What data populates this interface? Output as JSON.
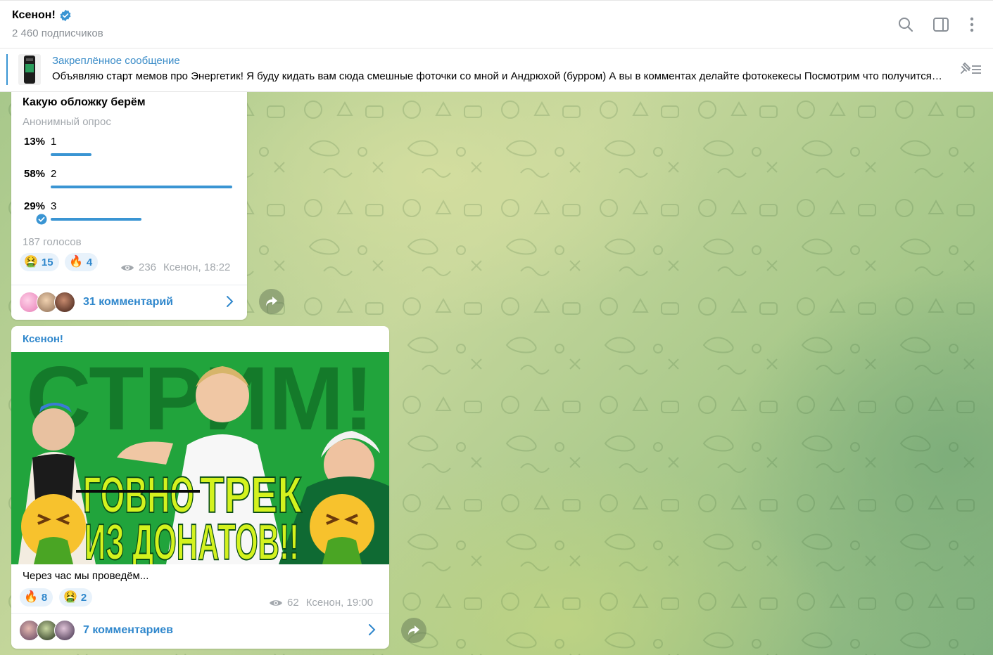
{
  "header": {
    "title": "Ксенон!",
    "subscribers": "2 460 подписчиков"
  },
  "pinned": {
    "title": "Закреплённое сообщение",
    "text": "Объявляю старт мемов про Энергетик! Я буду кидать вам сюда смешные фоточки со мной и Андрюхой (бурром) А вы в комментах делайте фотокекесы Посмотрим что получится ВАШИ ФОТОКЕКЕСЫ"
  },
  "poll": {
    "question": "Какую обложку берём",
    "type": "Анонимный опрос",
    "options": [
      {
        "percent": "13%",
        "label": "1",
        "fraction": 0.13
      },
      {
        "percent": "58%",
        "label": "2",
        "fraction": 0.58
      },
      {
        "percent": "29%",
        "label": "3",
        "fraction": 0.29,
        "voted": true
      }
    ],
    "votes": "187 голосов",
    "reactions": [
      {
        "emoji": "🤮",
        "count": "15"
      },
      {
        "emoji": "🔥",
        "count": "4"
      }
    ],
    "views": "236",
    "meta": "Ксенон, 18:22",
    "comments": "31 комментарий"
  },
  "post": {
    "author": "Ксенон!",
    "image_text": {
      "top": "СТРИМ!",
      "line1_struck": "ГОВНО",
      "line1": "ТРЕК",
      "line2": "ИЗ ДОНАТОВ!!"
    },
    "caption": "Через час мы проведём...",
    "reactions": [
      {
        "emoji": "🔥",
        "count": "8"
      },
      {
        "emoji": "🤮",
        "count": "2"
      }
    ],
    "views": "62",
    "meta": "Ксенон, 19:00",
    "comments": "7 комментариев"
  },
  "colors": {
    "accent": "#2f87cc",
    "pin_title": "#3a8cc8",
    "poll_bar": "#3a95d3",
    "muted": "#a3a8ad",
    "image_bg": "#21a43c",
    "image_text": "#d4f21e"
  }
}
